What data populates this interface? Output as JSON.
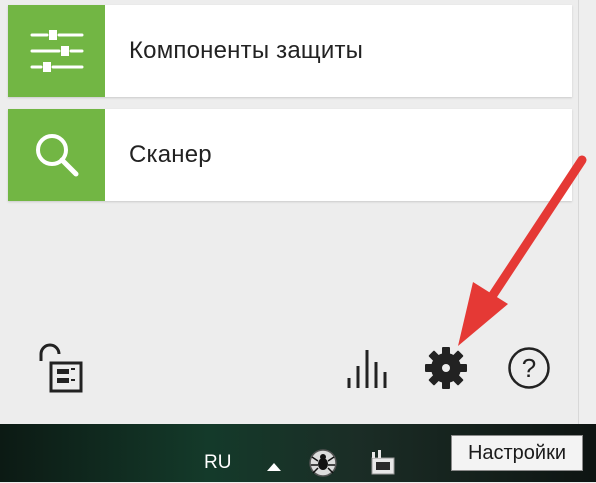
{
  "menu": {
    "items": [
      {
        "label": "Компоненты защиты",
        "icon": "sliders-icon"
      },
      {
        "label": "Сканер",
        "icon": "search-icon"
      }
    ]
  },
  "toolbar": {
    "icons": [
      "unlock-icon",
      "statistics-icon",
      "gear-icon",
      "help-icon"
    ],
    "help_glyph": "?"
  },
  "taskbar": {
    "language": "RU",
    "tray_icons": [
      "show-hidden-icons-arrow",
      "drweb-spider-icon",
      "network-icon"
    ]
  },
  "tooltip": {
    "text": "Настройки"
  },
  "colors": {
    "accent_green": "#72b644",
    "annotation_arrow": "#e53935",
    "panel_bg": "#ededed"
  }
}
